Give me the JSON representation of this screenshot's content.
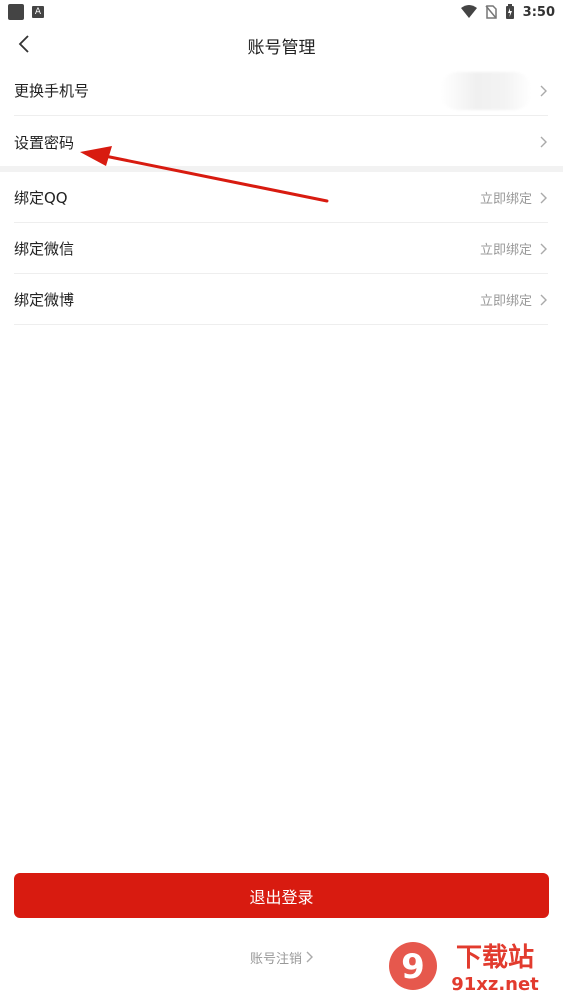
{
  "status": {
    "time": "3:50",
    "a_label": "A"
  },
  "header": {
    "title": "账号管理"
  },
  "rows": [
    {
      "label": "更换手机号",
      "value": ""
    },
    {
      "label": "设置密码",
      "value": ""
    },
    {
      "label": "绑定QQ",
      "value": "立即绑定"
    },
    {
      "label": "绑定微信",
      "value": "立即绑定"
    },
    {
      "label": "绑定微博",
      "value": "立即绑定"
    }
  ],
  "actions": {
    "logout": "退出登录",
    "cancel": "账号注销"
  },
  "watermark": {
    "brand_text": "下载站",
    "domain": "91xz.net",
    "mark": "9"
  },
  "colors": {
    "accent": "#d81b10",
    "annotation_arrow": "#d81b10"
  }
}
